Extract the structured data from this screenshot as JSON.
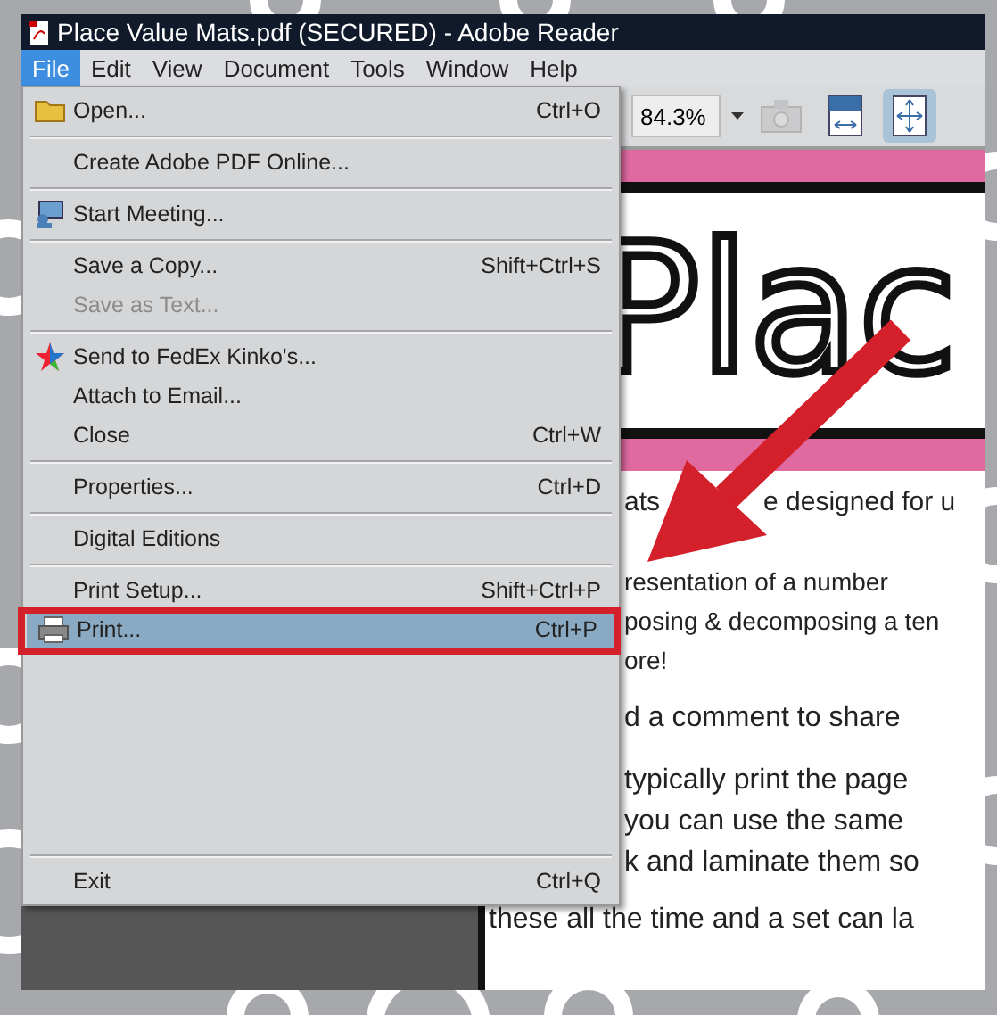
{
  "window": {
    "title": "Place Value Mats.pdf (SECURED) - Adobe Reader"
  },
  "menu_bar": [
    {
      "label": "File",
      "selected": true
    },
    {
      "label": "Edit",
      "selected": false
    },
    {
      "label": "View",
      "selected": false
    },
    {
      "label": "Document",
      "selected": false
    },
    {
      "label": "Tools",
      "selected": false
    },
    {
      "label": "Window",
      "selected": false
    },
    {
      "label": "Help",
      "selected": false
    }
  ],
  "toolbar": {
    "zoom": "84.3%",
    "buttons": [
      {
        "disabled": true,
        "selected": false
      },
      {
        "disabled": false,
        "selected": false
      },
      {
        "disabled": false,
        "selected": true
      }
    ]
  },
  "file_menu": [
    {
      "kind": "item",
      "label": "Open...",
      "shortcut": "Ctrl+O",
      "disabled": false,
      "selected": false
    },
    {
      "kind": "separator"
    },
    {
      "kind": "item",
      "label": "Create Adobe PDF Online...",
      "disabled": false,
      "selected": false
    },
    {
      "kind": "separator"
    },
    {
      "kind": "item",
      "label": "Start Meeting...",
      "disabled": false,
      "selected": false
    },
    {
      "kind": "separator"
    },
    {
      "kind": "item",
      "label": "Save a Copy...",
      "shortcut": "Shift+Ctrl+S",
      "disabled": false,
      "selected": false
    },
    {
      "kind": "item",
      "label": "Save as Text...",
      "disabled": true,
      "selected": false
    },
    {
      "kind": "separator"
    },
    {
      "kind": "item",
      "label": "Send to FedEx Kinko's...",
      "disabled": false,
      "selected": false
    },
    {
      "kind": "item",
      "label": "Attach to Email...",
      "disabled": false,
      "selected": false
    },
    {
      "kind": "item",
      "label": "Close",
      "shortcut": "Ctrl+W",
      "disabled": false,
      "selected": false
    },
    {
      "kind": "separator"
    },
    {
      "kind": "item",
      "label": "Properties...",
      "shortcut": "Ctrl+D",
      "disabled": false,
      "selected": false
    },
    {
      "kind": "separator"
    },
    {
      "kind": "item",
      "label": "Digital Editions",
      "disabled": false,
      "selected": false
    },
    {
      "kind": "separator"
    },
    {
      "kind": "item",
      "label": "Print Setup...",
      "shortcut": "Shift+Ctrl+P",
      "disabled": false,
      "selected": false
    },
    {
      "kind": "item",
      "label": "Print...",
      "shortcut": "Ctrl+P",
      "disabled": false,
      "selected": true
    },
    {
      "kind": "separator"
    },
    {
      "kind": "item",
      "label": "Exit",
      "shortcut": "Ctrl+Q",
      "disabled": false,
      "selected": false
    }
  ],
  "document": {
    "heading": "Plac",
    "lines": [
      [
        "ats",
        "e designed for u"
      ],
      [
        "resentation of a number"
      ],
      [
        "posing & decomposing a ten"
      ],
      [
        "ore!"
      ],
      [
        "d a comment to share"
      ],
      [
        "typically print the page"
      ],
      [
        "you can use the same"
      ],
      [
        "k and laminate them so"
      ],
      [
        "these all the time and a set can la"
      ]
    ]
  }
}
